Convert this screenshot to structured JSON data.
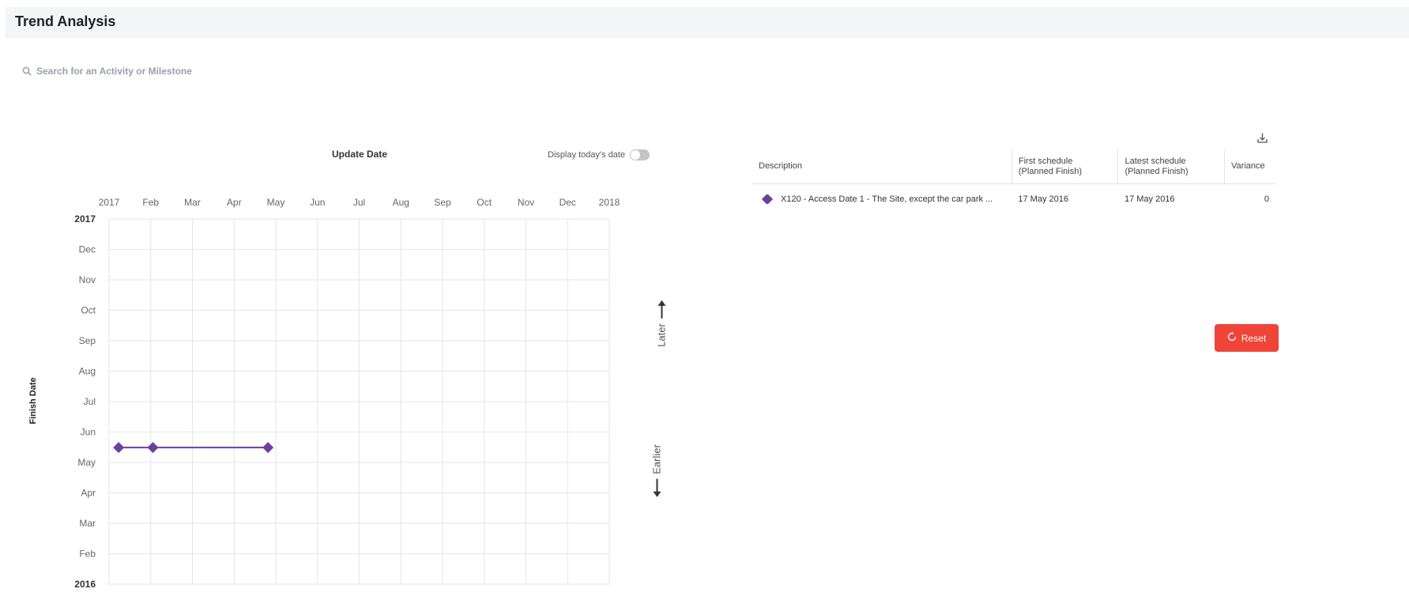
{
  "header": {
    "title": "Trend Analysis"
  },
  "search": {
    "placeholder": "Search for an Activity or Milestone",
    "icon": "search-icon"
  },
  "chart": {
    "x_axis_title": "Update Date",
    "y_axis_title": "Finish Date",
    "toggle_label": "Display today's date",
    "toggle_on": false,
    "later_label": "Later",
    "earlier_label": "Earlier"
  },
  "chart_data": {
    "type": "line",
    "x_ticks": [
      "2017",
      "Feb",
      "Mar",
      "Apr",
      "May",
      "Jun",
      "Jul",
      "Aug",
      "Sep",
      "Oct",
      "Nov",
      "Dec",
      "2018"
    ],
    "y_ticks": [
      "2016",
      "Feb",
      "Mar",
      "Apr",
      "May",
      "Jun",
      "Jul",
      "Aug",
      "Sep",
      "Oct",
      "Nov",
      "Dec",
      "2017"
    ],
    "xlabel": "Update Date",
    "ylabel": "Finish Date",
    "xlim": [
      "2017-01-01",
      "2018-01-01"
    ],
    "ylim": [
      "2016-01-01",
      "2017-01-01"
    ],
    "grid": true,
    "series": [
      {
        "color": "#6b3fa0",
        "marker": "diamond",
        "points": [
          {
            "x": "2017-01-08",
            "y": "2016-05-17"
          },
          {
            "x": "2017-02-02",
            "y": "2016-05-17"
          },
          {
            "x": "2017-04-27",
            "y": "2016-05-17"
          }
        ]
      }
    ]
  },
  "table": {
    "download_icon": "download-icon",
    "headers": {
      "description": "Description",
      "first_line1": "First schedule",
      "first_line2": "(Planned Finish)",
      "latest_line1": "Latest schedule",
      "latest_line2": "(Planned Finish)",
      "variance": "Variance"
    },
    "rows": [
      {
        "marker_color": "#6b3fa0",
        "description": "X120 - Access Date 1 - The Site, except the car park ...",
        "first": "17 May 2016",
        "latest": "17 May 2016",
        "variance": "0"
      }
    ]
  },
  "reset": {
    "label": "Reset",
    "color": "#f04438",
    "icon": "reset-icon"
  }
}
